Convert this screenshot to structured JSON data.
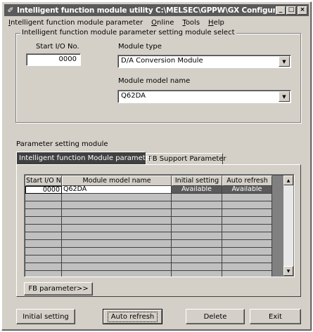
{
  "window": {
    "title": "Intelligent function module utility C:\\MELSEC\\GPPW\\GX Configura...",
    "icon": "pen-icon",
    "buttons": {
      "minimize": "_",
      "maximize": "□",
      "close": "×"
    }
  },
  "menu": {
    "items": [
      {
        "pre": "",
        "key": "I",
        "post": "ntelligent function module parameter"
      },
      {
        "pre": "",
        "key": "O",
        "post": "nline"
      },
      {
        "pre": "",
        "key": "T",
        "post": "ools"
      },
      {
        "pre": "",
        "key": "H",
        "post": "elp"
      }
    ]
  },
  "select_group": {
    "legend": "Intelligent function module parameter setting module select",
    "start_io_label": "Start I/O No.",
    "start_io_value": "0000",
    "module_type_label": "Module type",
    "module_type_value": "D/A Conversion Module",
    "model_name_label": "Module model name",
    "model_name_value": "Q62DA"
  },
  "param_section": {
    "label": "Parameter setting module",
    "tabs": [
      "Intelligent function Module parameter",
      "FB Support Parameter"
    ],
    "columns": [
      "Start I/O No.",
      "Module model name",
      "Initial setting",
      "Auto refresh"
    ],
    "rows": [
      [
        "0000",
        "Q62DA",
        "Available",
        "Available"
      ]
    ],
    "empty_rows": 11,
    "fb_button": "FB parameter>>"
  },
  "footer_buttons": {
    "initial_setting": "Initial setting",
    "auto_refresh": "Auto refresh",
    "delete": "Delete",
    "exit": "Exit"
  }
}
